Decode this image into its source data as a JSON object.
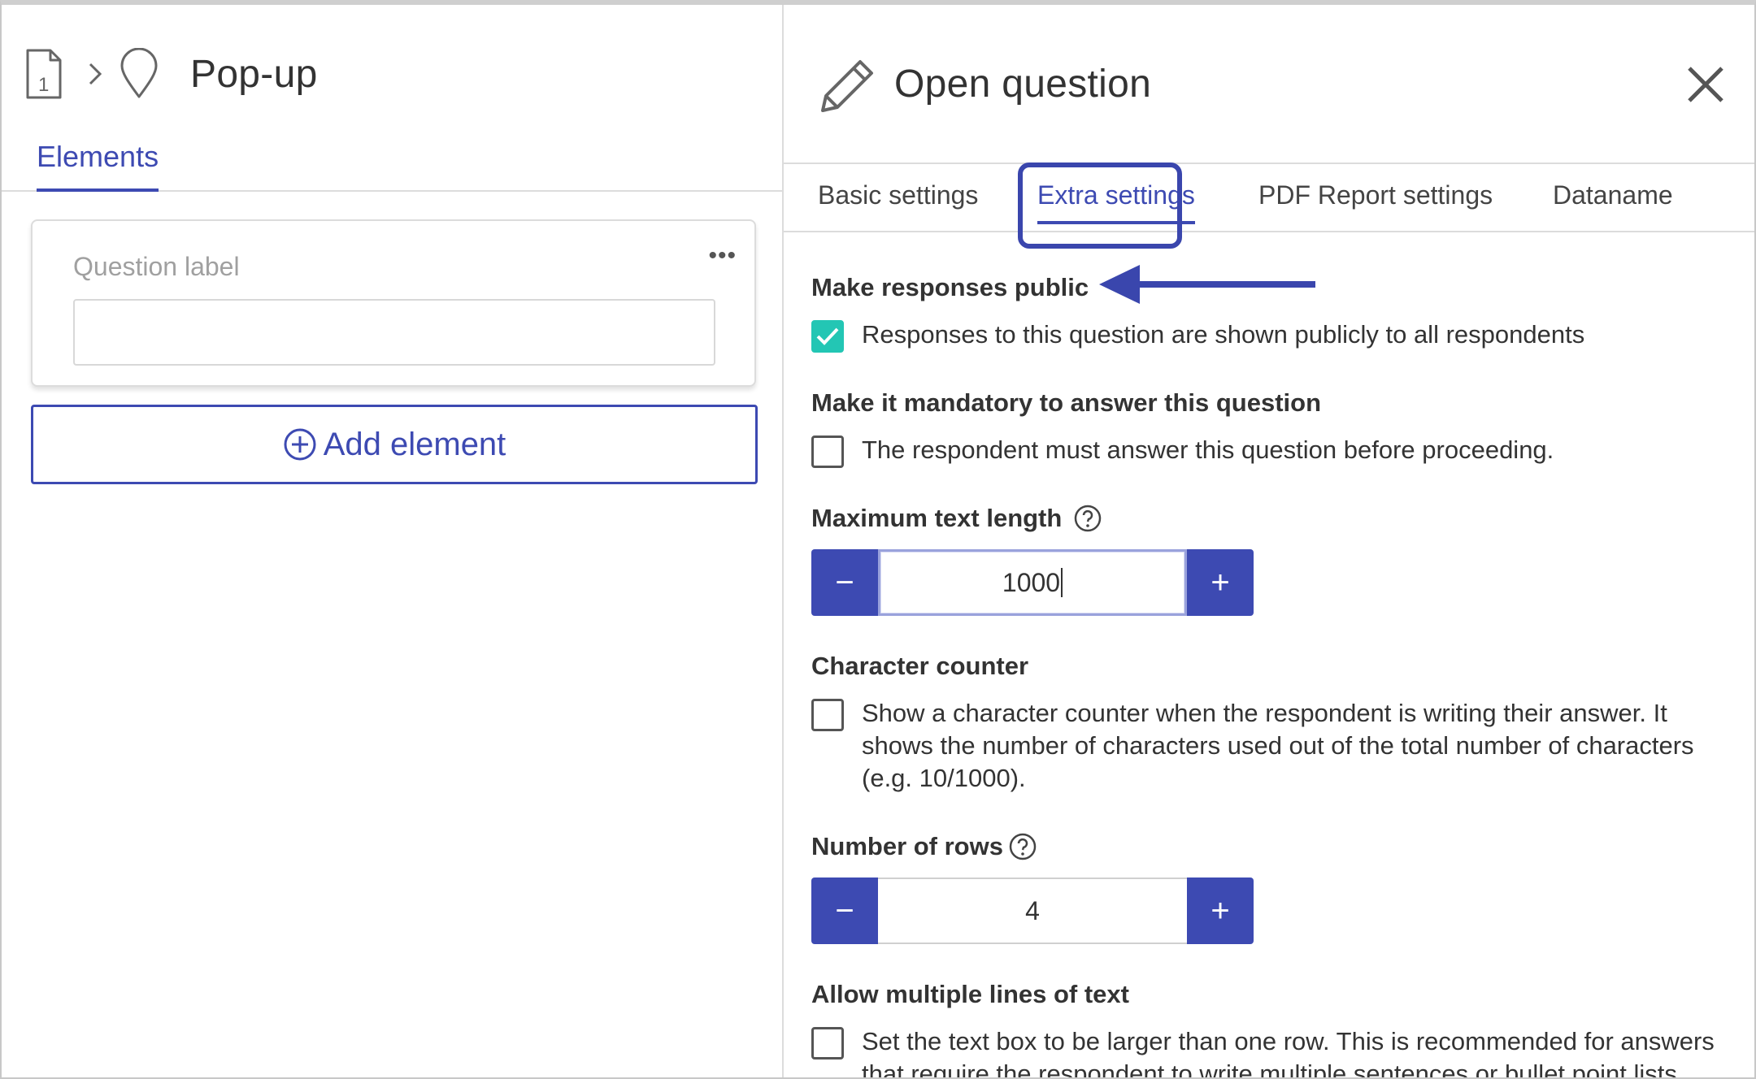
{
  "left_panel": {
    "breadcrumb_title": "Pop-up",
    "page_number": "1",
    "tab_label": "Elements",
    "question_card": {
      "label_placeholder": "Question label",
      "more_label": "•••",
      "input_value": ""
    },
    "add_element_label": "Add element"
  },
  "right_panel": {
    "title": "Open question",
    "tabs": [
      {
        "label": "Basic settings",
        "active": false
      },
      {
        "label": "Extra settings",
        "active": true
      },
      {
        "label": "PDF Report settings",
        "active": false
      },
      {
        "label": "Dataname",
        "active": false
      }
    ],
    "sections": {
      "public": {
        "heading": "Make responses public",
        "checkbox_text": "Responses to this question are shown publicly to all respondents",
        "checked": true
      },
      "mandatory": {
        "heading": "Make it mandatory to answer this question",
        "checkbox_text": "The respondent must answer this question before proceeding.",
        "checked": false
      },
      "max_length": {
        "heading": "Maximum text length",
        "value": "1000",
        "minus_label": "−",
        "plus_label": "+"
      },
      "char_counter": {
        "heading": "Character counter",
        "checkbox_text": "Show a character counter when the respondent is writing their answer. It shows the number of characters used out of the total number of characters (e.g. 10/1000).",
        "checked": false
      },
      "rows": {
        "heading": "Number of rows",
        "value": "4",
        "minus_label": "−",
        "plus_label": "+"
      },
      "multiline": {
        "heading": "Allow multiple lines of text",
        "checkbox_text": "Set the text box to be larger than one row. This is recommended for answers that require the respondent to write multiple sentences or bullet point lists.",
        "checked": false
      }
    }
  },
  "colors": {
    "accent": "#3d4ab2",
    "check": "#23c6b4",
    "annotation": "#3a46ad"
  }
}
